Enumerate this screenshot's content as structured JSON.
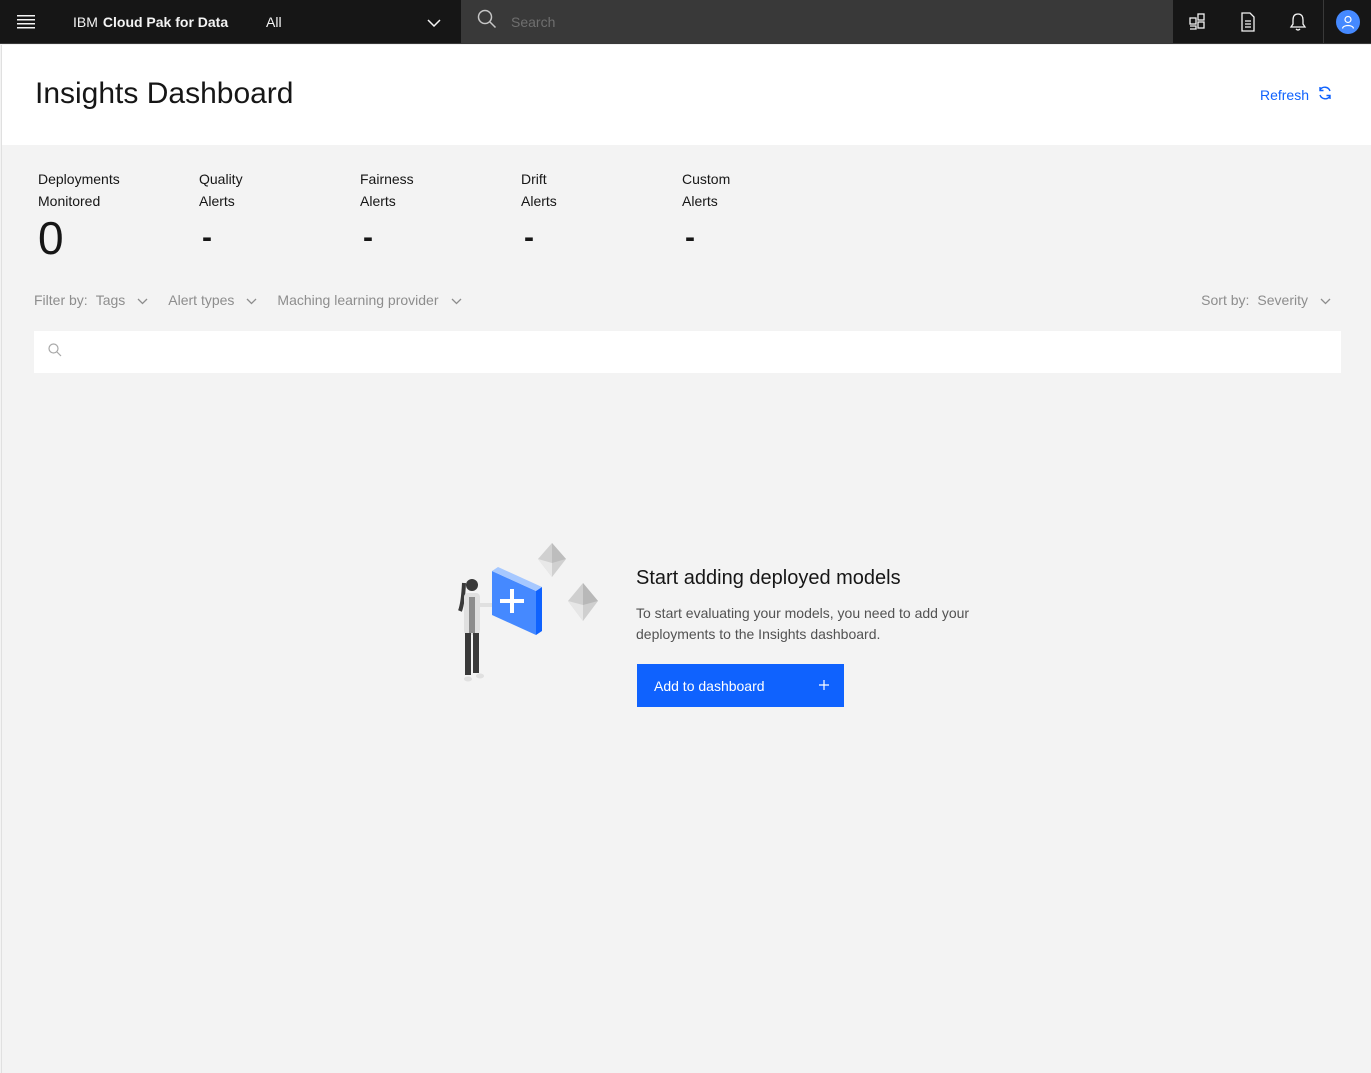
{
  "header": {
    "brand_prefix": "IBM",
    "brand_name": "Cloud Pak for Data",
    "scope_value": "All",
    "search_placeholder": "Search",
    "icons": [
      "menu-icon",
      "chevron-down-icon",
      "search-icon",
      "catalog-icon",
      "document-icon",
      "notification-icon",
      "user-avatar-icon"
    ]
  },
  "page": {
    "title": "Insights Dashboard",
    "refresh_label": "Refresh"
  },
  "stats": [
    {
      "label": "Deployments\nMonitored",
      "value": "0"
    },
    {
      "label": "Quality\nAlerts",
      "value": "-"
    },
    {
      "label": "Fairness\nAlerts",
      "value": "-"
    },
    {
      "label": "Drift\nAlerts",
      "value": "-"
    },
    {
      "label": "Custom\nAlerts",
      "value": "-"
    }
  ],
  "filters": {
    "label": "Filter by:",
    "options": [
      "Tags",
      "Alert types",
      "Maching learning provider"
    ],
    "sort_label": "Sort by:",
    "sort_value": "Severity"
  },
  "list_search": {
    "placeholder": ""
  },
  "empty_state": {
    "title": "Start adding deployed models",
    "description": "To start evaluating your models, you need to add your deployments to the Insights dashboard.",
    "button_label": "Add to dashboard"
  },
  "colors": {
    "primary": "#0f62fe",
    "header_bg": "#161616",
    "search_bg": "#393939",
    "page_bg": "#f3f3f3"
  }
}
